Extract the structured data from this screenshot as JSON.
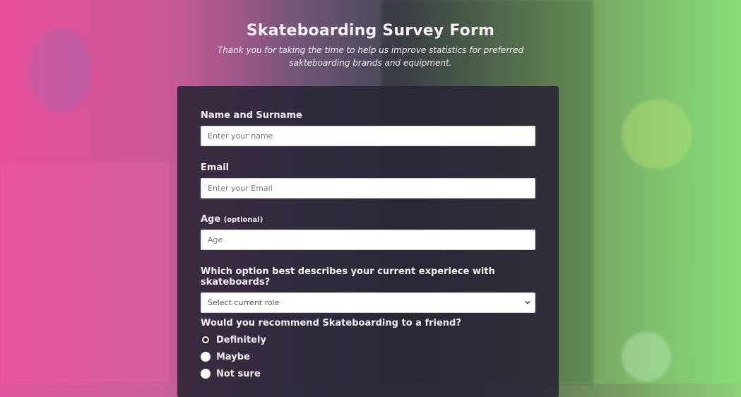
{
  "header": {
    "title": "Skateboarding Survey Form",
    "description": "Thank you for taking the time to help us improve statistics for preferred sakteboarding brands and equipment."
  },
  "form": {
    "name": {
      "label": "Name and Surname",
      "placeholder": "Enter your name",
      "value": ""
    },
    "email": {
      "label": "Email",
      "placeholder": "Enter your Email",
      "value": ""
    },
    "age": {
      "label": "Age",
      "optional_label": "(optional)",
      "placeholder": "Age",
      "value": ""
    },
    "experience": {
      "label": "Which option best describes your current experiece with skateboards?",
      "selected": "Select current role"
    },
    "recommend": {
      "label": "Would you recommend Skateboarding to a friend?",
      "options": [
        "Definitely",
        "Maybe",
        "Not sure"
      ],
      "selected_index": 0
    }
  },
  "icons": {
    "select_arrow": "chevron-down-icon",
    "radio": "radio-button"
  },
  "colors": {
    "card_bg": "#28243a",
    "left_tint": "#ec4899",
    "right_tint": "#82e678",
    "text": "#f1eef3"
  }
}
